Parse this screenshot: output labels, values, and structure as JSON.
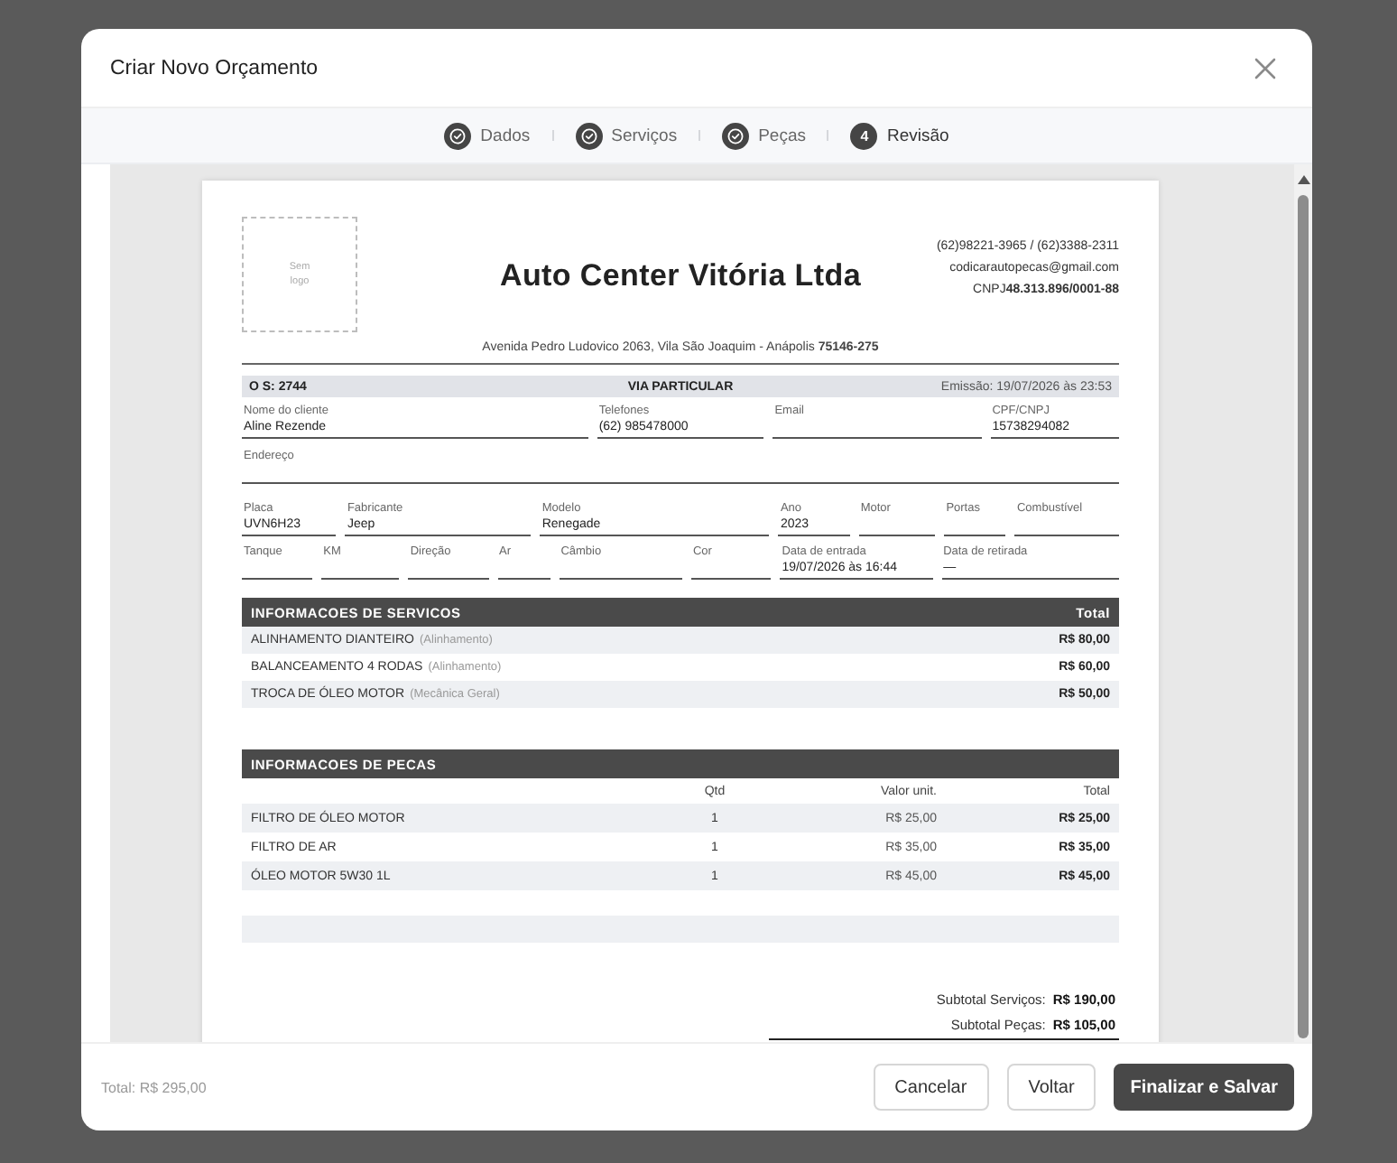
{
  "modal": {
    "title": "Criar Novo Orçamento"
  },
  "steps": [
    {
      "label": "Dados",
      "completed": true,
      "selected": false
    },
    {
      "label": "Serviços",
      "completed": true,
      "selected": false
    },
    {
      "label": "Peças",
      "completed": true,
      "selected": false
    },
    {
      "label": "Revisão",
      "completed": false,
      "selected": true,
      "number": "4"
    }
  ],
  "document": {
    "logo_placeholder": "Sem logo",
    "company_name": "Auto Center Vitória Ltda",
    "contacts": [
      "(62)98221-3965 / (62)3388-2311",
      "codicarautopecas@gmail.com",
      "CNPJ**48.313.896/0001-88**"
    ],
    "address": "Avenida Pedro Ludovico 2063, Vila São Joaquim - Anápolis **75146-275**",
    "order_bar": {
      "order": "O S: 2744",
      "copy": "VIA PARTICULAR",
      "issued": "Emissão: 19/07/2026 às 23:53"
    },
    "field_rows": [
      [
        {
          "label": "Nome do cliente",
          "value": "Aline Rezende"
        },
        {
          "label": "Telefones",
          "value": "(62) 985478000"
        },
        {
          "label": "Email"
        },
        {
          "label": "CPF/CNPJ",
          "value": "15738294082"
        }
      ],
      [
        {
          "label": "Endereço"
        }
      ],
      [
        {
          "label": "Placa",
          "value": "UVN6H23"
        },
        {
          "label": "Fabricante",
          "value": "Jeep"
        },
        {
          "label": "Modelo",
          "value": "Renegade"
        },
        {
          "label": "Ano",
          "value": "2023"
        },
        {
          "label": "Motor"
        },
        {
          "label": "Portas"
        },
        {
          "label": "Combustível"
        }
      ],
      [
        {
          "label": "Tanque"
        },
        {
          "label": "KM"
        },
        {
          "label": "Direção"
        },
        {
          "label": "Ar"
        },
        {
          "label": "Câmbio"
        },
        {
          "label": "Cor"
        },
        {
          "label": "Data de entrada",
          "value": "19/07/2026 às 16:44"
        },
        {
          "label": "Data de retirada",
          "value": "—"
        }
      ]
    ],
    "services": {
      "title": "INFORMACOES DE SERVICOS",
      "total_heading": "Total",
      "rows": [
        {
          "name": "ALINHAMENTO DIANTEIRO",
          "category": "(Alinhamento)",
          "total": "R$ 80,00"
        },
        {
          "name": "BALANCEAMENTO 4 RODAS",
          "category": "(Alinhamento)",
          "total": "R$ 60,00"
        },
        {
          "name": "TROCA DE ÓLEO MOTOR",
          "category": "(Mecânica Geral)",
          "total": "R$ 50,00"
        }
      ]
    },
    "parts": {
      "title": "INFORMACOES DE PECAS",
      "columns": [
        "Qtd",
        "Valor unit.",
        "Total"
      ],
      "rows": [
        {
          "name": "FILTRO DE ÓLEO MOTOR",
          "qty": "1",
          "unit_price": "R$ 25,00",
          "total": "R$ 25,00"
        },
        {
          "name": "FILTRO DE AR",
          "qty": "1",
          "unit_price": "R$ 35,00",
          "total": "R$ 35,00"
        },
        {
          "name": "ÓLEO MOTOR 5W30 1L",
          "qty": "1",
          "unit_price": "R$ 45,00",
          "total": "R$ 45,00"
        }
      ]
    },
    "subtotals": [
      {
        "label": "Subtotal Serviços:",
        "value": "R$ 190,00"
      },
      {
        "label": "Subtotal Peças:",
        "value": "R$ 105,00"
      }
    ]
  },
  "footer": {
    "total": "Total: R$ 295,00",
    "buttons": [
      {
        "label": "Cancelar",
        "kind": "secondary"
      },
      {
        "label": "Voltar",
        "kind": "secondary"
      },
      {
        "label": "Finalizar e Salvar",
        "kind": "primary"
      }
    ]
  }
}
